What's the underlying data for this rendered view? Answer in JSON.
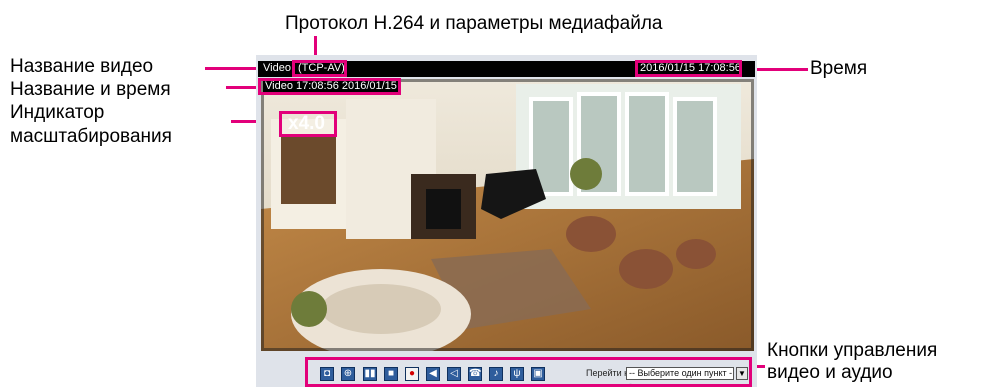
{
  "annotations": {
    "protocol": "Протокол H.264 и параметры медиафайла",
    "video_title": "Название видео",
    "title_and_time": "Название и время",
    "zoom_line1": "Индикатор",
    "zoom_line2": "масштабирования",
    "time": "Время",
    "controls_line1": "Кнопки управления",
    "controls_line2": "видео и аудио"
  },
  "viewer": {
    "title": "Video",
    "protocol": "(TCP-AV)",
    "timestamp": "2016/01/15  17:08:56",
    "overlay_caption": "Video 17:08:56 2016/01/15",
    "zoom_indicator": "x4.0"
  },
  "controls": {
    "buttons": [
      {
        "name": "snapshot-icon"
      },
      {
        "name": "zoom-icon"
      },
      {
        "name": "pause-icon"
      },
      {
        "name": "stop-icon"
      },
      {
        "name": "record-icon"
      },
      {
        "name": "volume-icon"
      },
      {
        "name": "mute-icon"
      },
      {
        "name": "talk-icon"
      },
      {
        "name": "speaker-icon"
      },
      {
        "name": "microphone-icon"
      },
      {
        "name": "fullscreen-icon"
      }
    ],
    "goto_label": "Перейти к",
    "goto_select": "-- Выберите один пункт --"
  },
  "colors": {
    "annotation_accent": "#e2007a",
    "frame_background": "#dfe3ea",
    "button_blue": "#2f5d9c"
  }
}
